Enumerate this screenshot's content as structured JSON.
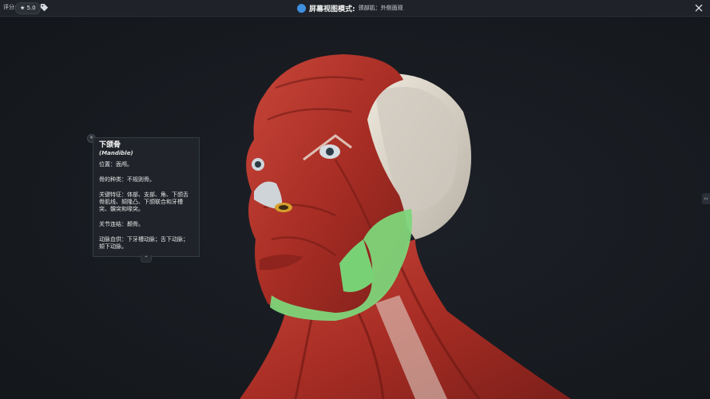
{
  "topbar": {
    "rating_label": "评分:",
    "rating_value": "★ 5.0",
    "title": "屏幕视图模式:",
    "subtitle": "颈部肌：外侧面观"
  },
  "info_panel": {
    "title": "下颌骨",
    "latin": "(Mandible)",
    "location": "位置：面颅。",
    "bone_type": "骨的种类：不规则骨。",
    "features": "关键特征：体部、支部、角、下颌舌骨肌线、颏隆凸、下颌联合和牙槽突、髁突和喙突。",
    "joints": "关节连结：颞骨。",
    "blood_supply": "动脉血供：下牙槽动脉；舌下动脉；颏下动脉。"
  },
  "icons": {
    "tag": "tag-icon",
    "mode": "screen-mode-icon",
    "close": "close-icon",
    "collapse": "chevron-up-icon",
    "side": "side-panel-handle-icon"
  },
  "colors": {
    "background": "#171a1f",
    "muscle": "#b8332a",
    "mandible_highlight": "#7ed57a",
    "bone": "#e3ddd2",
    "accent": "#3f8fe0"
  }
}
